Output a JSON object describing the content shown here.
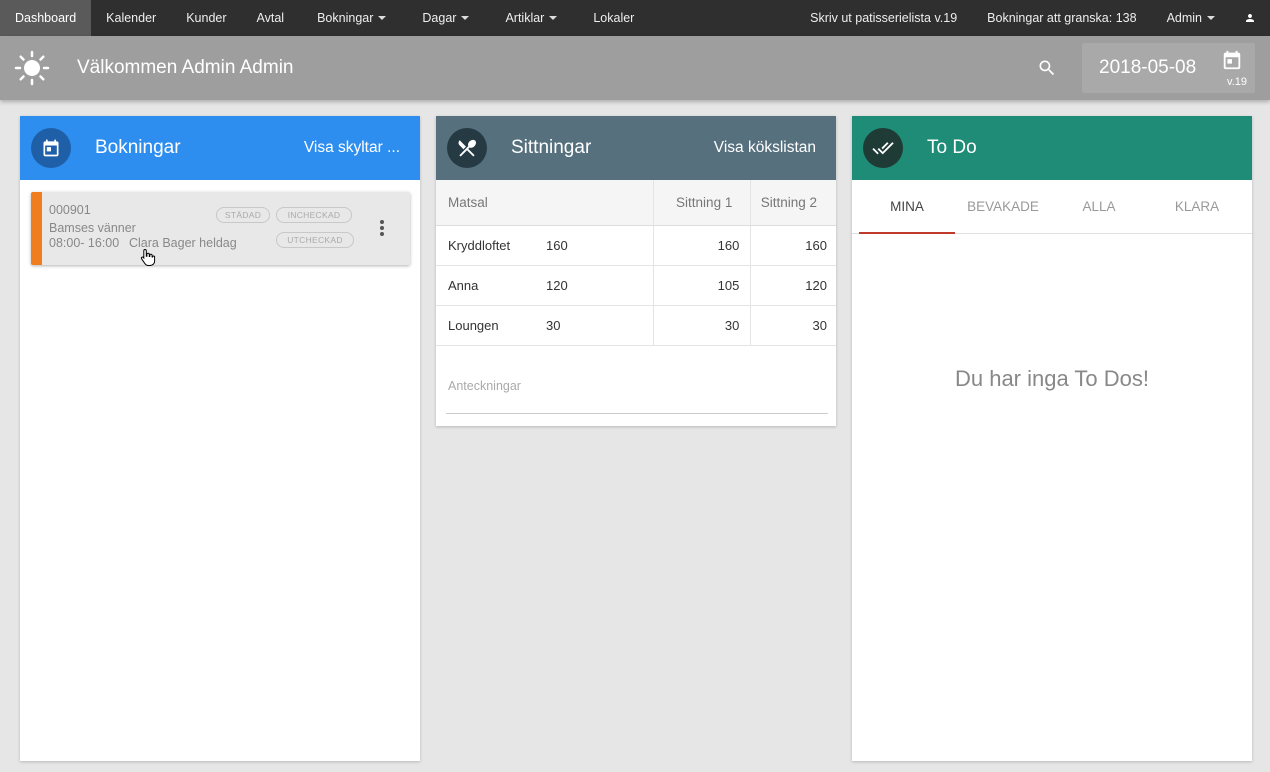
{
  "nav": {
    "items": [
      {
        "label": "Dashboard",
        "active": true,
        "dropdown": false
      },
      {
        "label": "Kalender",
        "active": false,
        "dropdown": false
      },
      {
        "label": "Kunder",
        "active": false,
        "dropdown": false
      },
      {
        "label": "Avtal",
        "active": false,
        "dropdown": false
      },
      {
        "label": "Bokningar",
        "active": false,
        "dropdown": true
      },
      {
        "label": "Dagar",
        "active": false,
        "dropdown": true
      },
      {
        "label": "Artiklar",
        "active": false,
        "dropdown": true
      },
      {
        "label": "Lokaler",
        "active": false,
        "dropdown": false
      }
    ],
    "print_label": "Skriv ut patisserielista v.19",
    "review_label": "Bokningar att granska: 138",
    "admin_label": "Admin"
  },
  "header": {
    "welcome": "Välkommen Admin Admin",
    "date": "2018-05-08",
    "week": "v.19"
  },
  "bookings_card": {
    "title": "Bokningar",
    "action": "Visa skyltar ...",
    "color": "#2d8ef0",
    "booking": {
      "number": "000901",
      "name": "Bamses vänner",
      "time": "08:00- 16:00",
      "description": "Clara Bager heldag",
      "tags": [
        "STÄDAD",
        "INCHECKAD",
        "UTCHECKAD"
      ],
      "accent": "#f07d1e"
    }
  },
  "sittings_card": {
    "title": "Sittningar",
    "action": "Visa kökslistan",
    "color": "#56707e",
    "columns": [
      "Matsal",
      "Sittning 1",
      "Sittning 2"
    ],
    "rows": [
      {
        "name": "Kryddloftet",
        "capacity": "160",
        "s1": "160",
        "s2": "160"
      },
      {
        "name": "Anna",
        "capacity": "120",
        "s1": "105",
        "s2": "120"
      },
      {
        "name": "Loungen",
        "capacity": "30",
        "s1": "30",
        "s2": "30"
      }
    ],
    "notes_placeholder": "Anteckningar"
  },
  "todo_card": {
    "title": "To Do",
    "color": "#1e8c76",
    "tabs": [
      "MINA",
      "BEVAKADE",
      "ALLA",
      "KLARA"
    ],
    "empty_text": "Du har inga To Dos!"
  }
}
